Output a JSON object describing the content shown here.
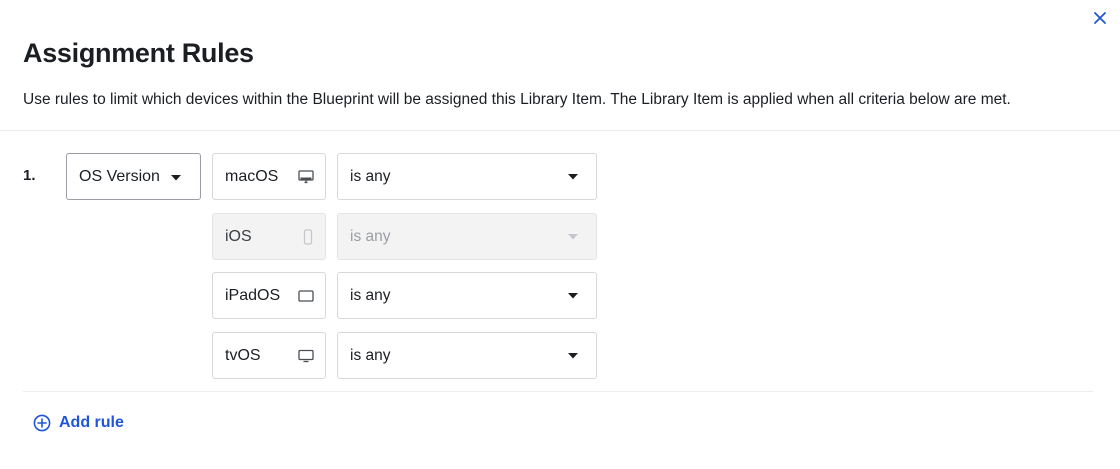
{
  "dialog": {
    "title": "Assignment Rules",
    "description": "Use rules to limit which devices within the Blueprint will be assigned this Library Item. The Library Item is applied when all criteria below are met.",
    "close_icon": "close-icon",
    "accent_color": "#1f56d9"
  },
  "rules": [
    {
      "number": "1.",
      "field": "OS Version",
      "conditions": [
        {
          "os": "macOS",
          "icon": "desktop-icon",
          "operator": "is any",
          "disabled": false
        },
        {
          "os": "iOS",
          "icon": "phone-icon",
          "operator": "is any",
          "disabled": true
        },
        {
          "os": "iPadOS",
          "icon": "tablet-icon",
          "operator": "is any",
          "disabled": false
        },
        {
          "os": "tvOS",
          "icon": "tv-icon",
          "operator": "is any",
          "disabled": false
        }
      ]
    }
  ],
  "footer": {
    "add_rule_label": "Add rule",
    "add_rule_icon": "plus-circle-icon"
  }
}
